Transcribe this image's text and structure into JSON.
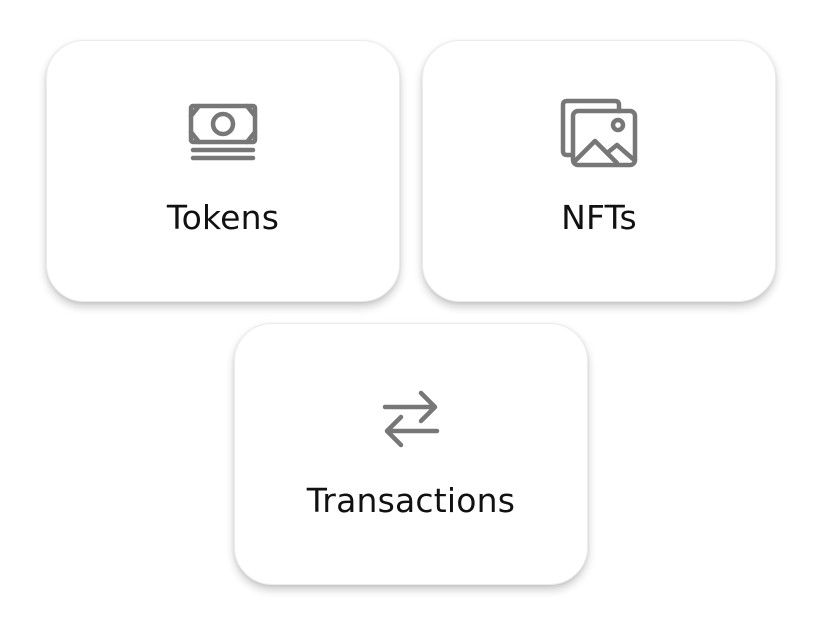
{
  "cards": [
    {
      "label": "Tokens",
      "icon": "banknote-icon"
    },
    {
      "label": "NFTs",
      "icon": "images-icon"
    },
    {
      "label": "Transactions",
      "icon": "arrows-left-right-icon"
    }
  ],
  "colors": {
    "icon": "#777777",
    "text": "#111111",
    "card_background": "#ffffff"
  }
}
